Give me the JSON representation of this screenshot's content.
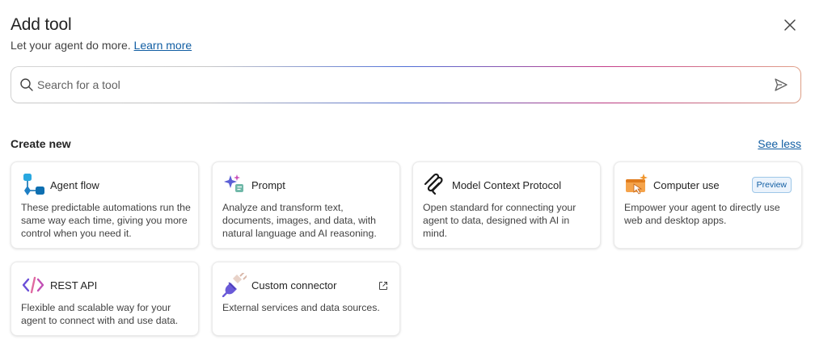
{
  "header": {
    "title": "Add tool",
    "subtitle": "Let your agent do more.",
    "learn_more": "Learn more"
  },
  "search": {
    "placeholder": "Search for a tool",
    "value": ""
  },
  "section": {
    "title": "Create new",
    "toggle_label": "See less"
  },
  "cards": [
    {
      "name": "Agent flow",
      "description": "These predictable automations run the same way each time, giving you more control when you need it.",
      "icon": "agent-flow-icon"
    },
    {
      "name": "Prompt",
      "description": "Analyze and transform text, documents, images, and data, with natural language and AI reasoning.",
      "icon": "prompt-icon"
    },
    {
      "name": "Model Context Protocol",
      "description": "Open standard for connecting your agent to data, designed with AI in mind.",
      "icon": "mcp-icon"
    },
    {
      "name": "Computer use",
      "description": "Empower your agent to directly use web and desktop apps.",
      "badge": "Preview",
      "icon": "computer-use-icon"
    },
    {
      "name": "REST API",
      "description": "Flexible and scalable way for your agent to connect with and use data.",
      "icon": "rest-api-icon"
    },
    {
      "name": "Custom connector",
      "description": "External services and data sources.",
      "icon": "custom-connector-icon",
      "external_link": true
    }
  ],
  "colors": {
    "link": "#115ea3",
    "text": "#242424",
    "badge_bg": "#ebf3fc"
  }
}
